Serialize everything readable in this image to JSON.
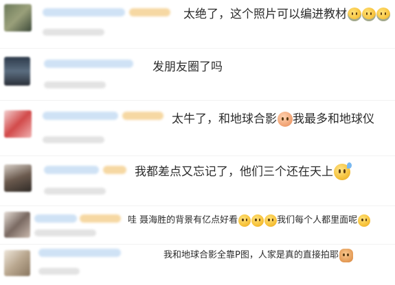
{
  "comments": [
    {
      "text": "太绝了，这个照片可以编进教材",
      "emoji": [
        "cry-icon",
        "cry-icon",
        "cry-icon"
      ]
    },
    {
      "text": "发朋友圈了吗",
      "emoji": []
    },
    {
      "text_a": "太牛了，和地球合影",
      "text_b": "我最多和地球仪",
      "emoji": [
        "face-palm-icon"
      ]
    },
    {
      "text": "我都差点又忘记了，他们三个还在天上",
      "emoji": [
        "sweat-icon"
      ]
    },
    {
      "text_a": "哇 聂海胜的背景有亿点好看",
      "text_b": "我们每个人都里面呢",
      "emoji": [
        "surprised-icon",
        "surprised-icon",
        "surprised-icon",
        "grin-icon"
      ]
    },
    {
      "text": "我和地球合影全靠P图，人家是真的直接拍耶",
      "emoji": [
        "cat-icon"
      ]
    }
  ],
  "colors": {
    "text": "#2b2b2b",
    "name_blur": "#cfe2f5",
    "badge_blur": "#f6d8a3",
    "meta_blur": "#e3e3e3"
  }
}
